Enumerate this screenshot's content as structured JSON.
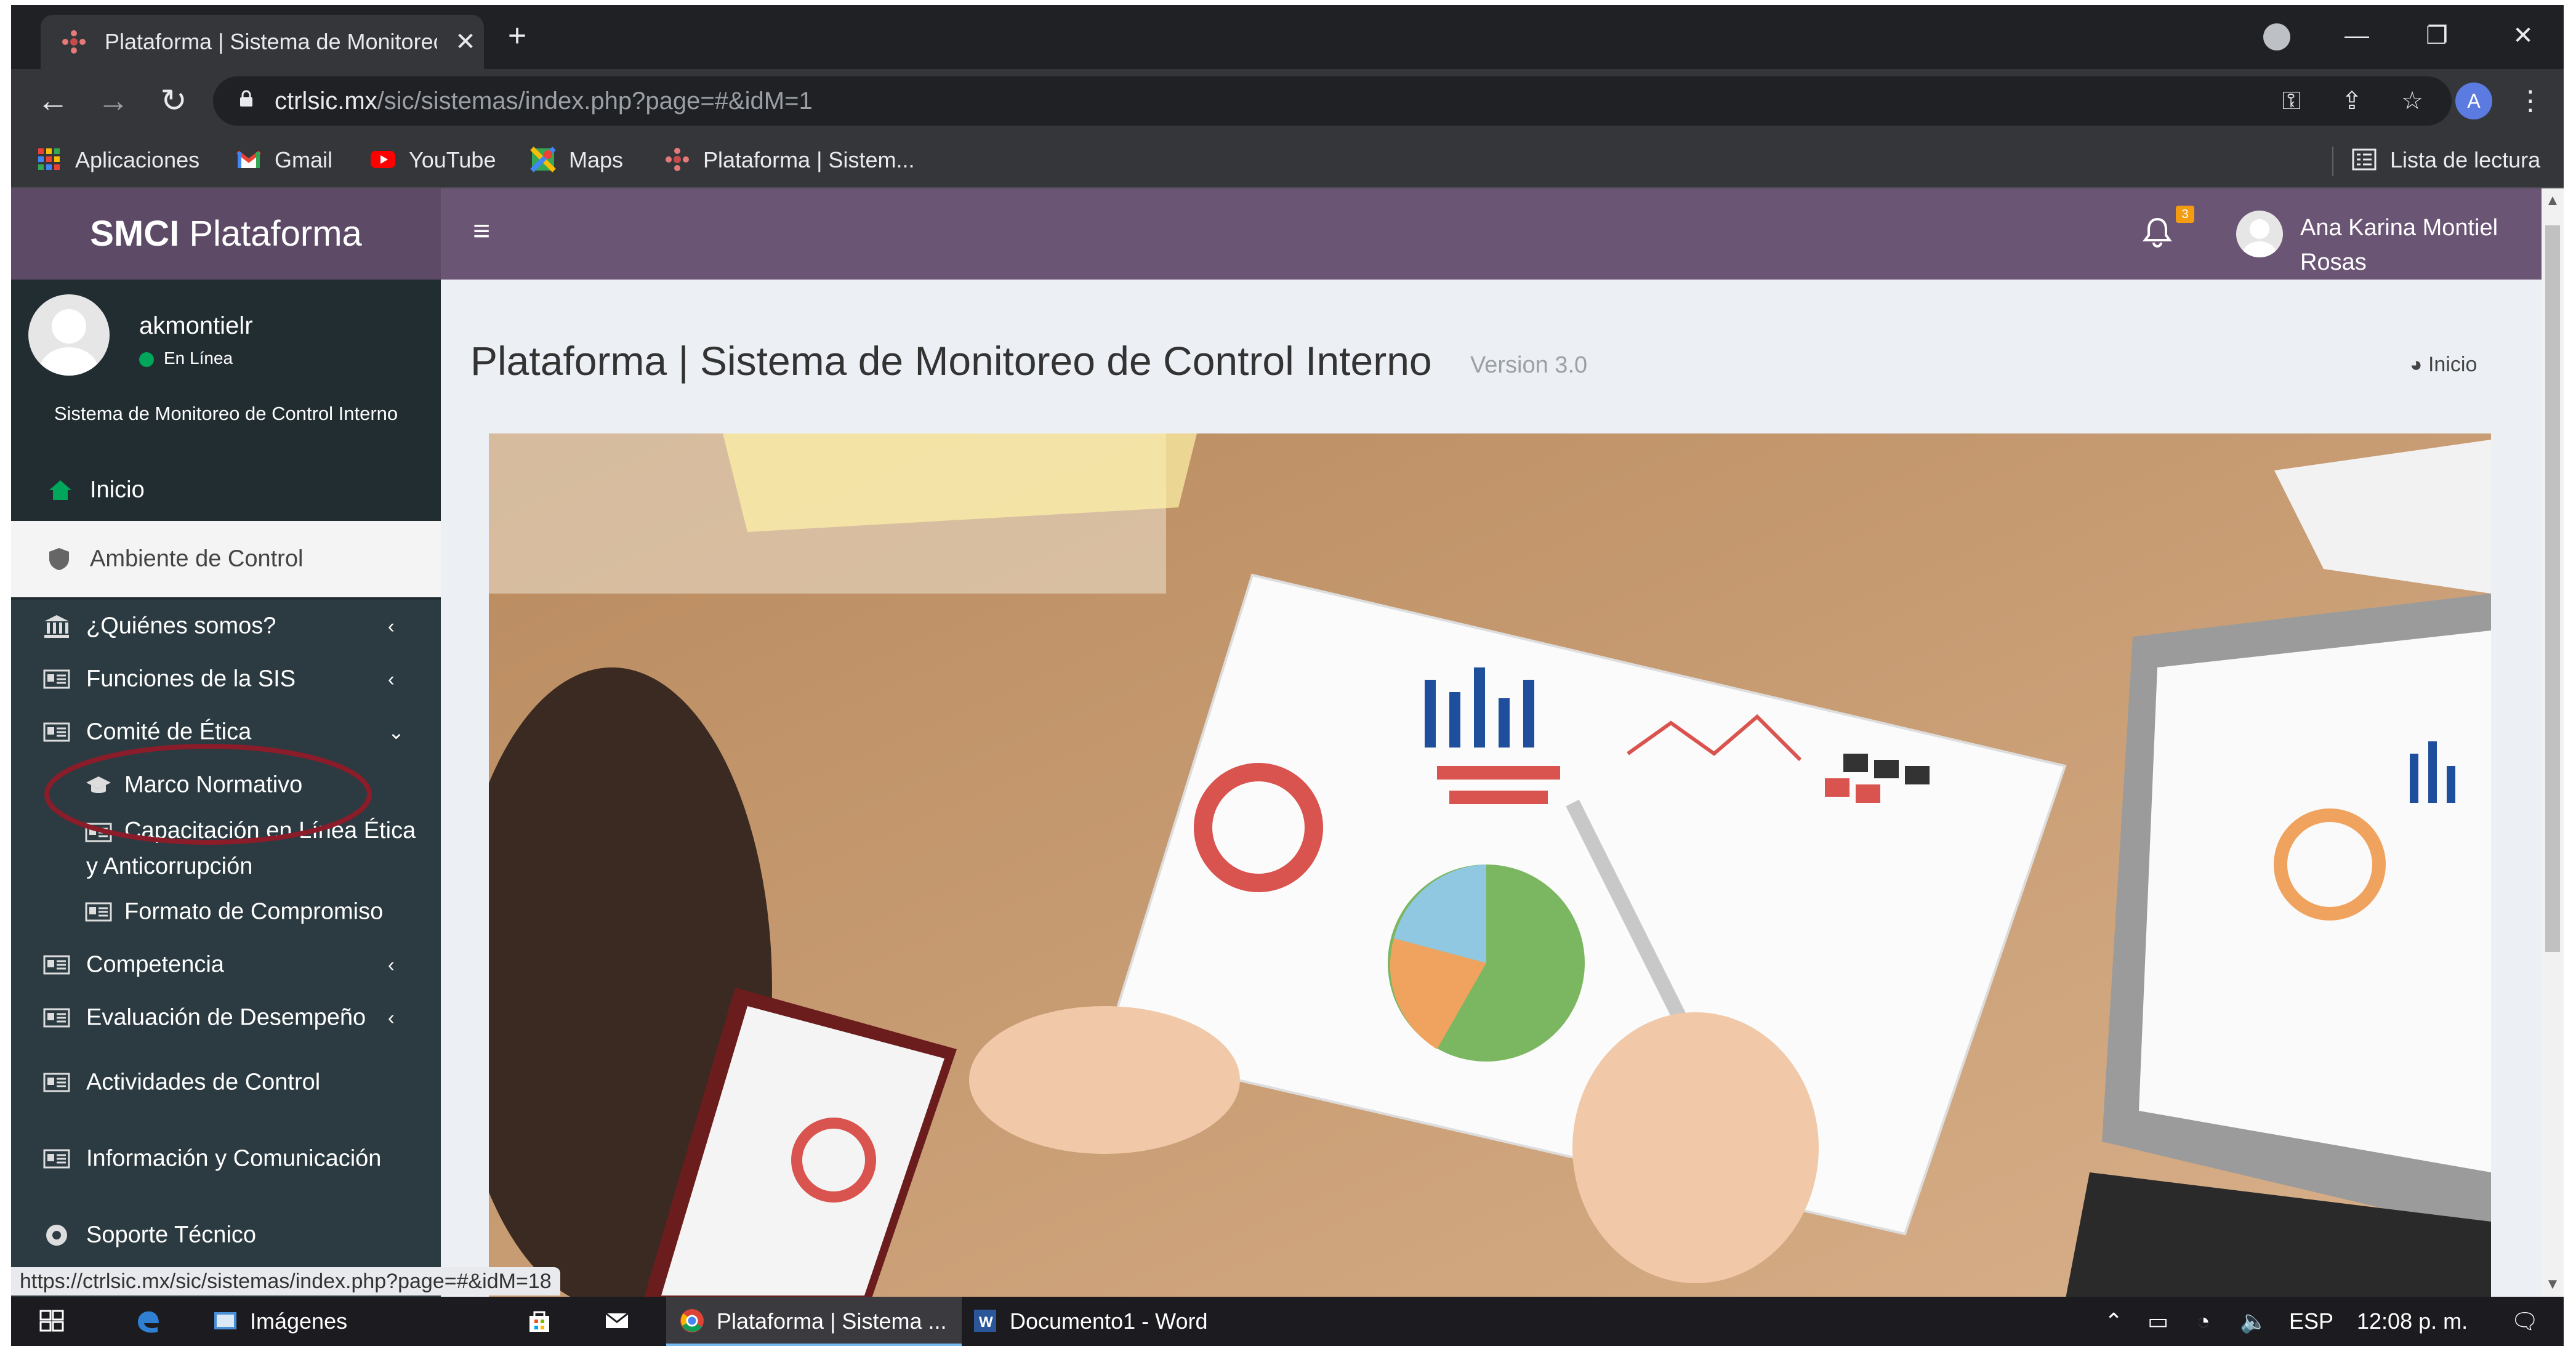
{
  "browser": {
    "tab_title": "Plataforma | Sistema de Monitoreo de Control Interno",
    "url_host": "ctrlsic.mx",
    "url_path": "/sic/sistemas/index.php?page=#&idM=1",
    "profile_initial": "A",
    "bookmarks": [
      "Aplicaciones",
      "Gmail",
      "YouTube",
      "Maps",
      "Plataforma | Sistem..."
    ],
    "reading_list": "Lista de lectura",
    "status_url": "https://ctrlsic.mx/sic/sistemas/index.php?page=#&idM=18"
  },
  "app": {
    "brand_bold": "SMCI",
    "brand_rest": " Plataforma",
    "notification_count": "3",
    "user_full_name": "Ana Karina Montiel Rosas"
  },
  "sidebar": {
    "username": "akmontielr",
    "status": "En Línea",
    "system_name": "Sistema de Monitoreo de Control Interno",
    "items": {
      "inicio": "Inicio",
      "ambiente": "Ambiente de Control",
      "quienes": "¿Quiénes somos?",
      "funciones": "Funciones de la SIS",
      "comite": "Comité de Ética",
      "marco": "Marco Normativo",
      "capacitacion": "Capacitación en Línea Ética y Anticorrupción",
      "formato": "Formato de Compromiso",
      "competencia": "Competencia",
      "evaluacion": "Evaluación de Desempeño",
      "actividades": "Actividades de Control",
      "informacion": "Información y Comunicación",
      "soporte": "Soporte Técnico"
    }
  },
  "content": {
    "title": "Plataforma | Sistema de Monitoreo de Control Interno",
    "version": "Version 3.0",
    "breadcrumb": "Inicio"
  },
  "taskbar": {
    "imagenes": "Imágenes",
    "chrome_window": "Plataforma | Sistema ...",
    "word_window": "Documento1 - Word",
    "language": "ESP",
    "clock": "12:08 p. m."
  },
  "colors": {
    "topbar": "#6b5574",
    "brand": "#5d4a66",
    "sidebar": "#222d32",
    "online": "#00a65a",
    "highlight_circle": "#8b1c2a"
  }
}
